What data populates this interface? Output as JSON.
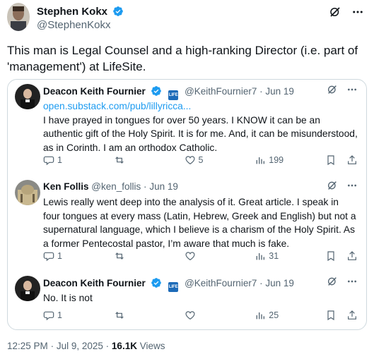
{
  "post": {
    "author_name": "Stephen Kokx",
    "author_handle": "@StephenKokx",
    "text": "This man is Legal Counsel and a high-ranking Director (i.e. part of 'management') at LifeSite.",
    "time": "12:25 PM",
    "date": "Jul 9, 2025",
    "views_count": "16.1K",
    "views_label": "Views"
  },
  "replies": [
    {
      "name": "Deacon Keith Fournier",
      "handle": "@KeithFournier7",
      "date": "Jun 19",
      "badge": "LIFE",
      "link": "open.substack.com/pub/lillyricca...",
      "text": "I have prayed in tongues for over 50 years. I KNOW it can be an authentic gift of the Holy Spirit. It is for me.  And, it can be misunderstood,  as in Corinth. I am an orthodox Catholic.",
      "replies": "1",
      "likes": "5",
      "views": "199"
    },
    {
      "name": "Ken Follis",
      "handle": "@ken_follis",
      "date": "Jun 19",
      "text": "Lewis really went deep into the analysis of it. Great article. I speak in four tongues at every mass (Latin, Hebrew, Greek and English) but not a supernatural language, which I believe is a charism of the Holy Spirit. As a former Pentecostal pastor, I’m aware that much is  fake.",
      "replies": "1",
      "views": "31"
    },
    {
      "name": "Deacon Keith Fournier",
      "handle": "@KeithFournier7",
      "date": "Jun 19",
      "badge": "LIFE",
      "text": "No. It is not",
      "replies": "1",
      "views": "25"
    }
  ],
  "colors": {
    "accent": "#1d9bf0",
    "secondary_text": "#536471",
    "border": "#cfd9de"
  }
}
